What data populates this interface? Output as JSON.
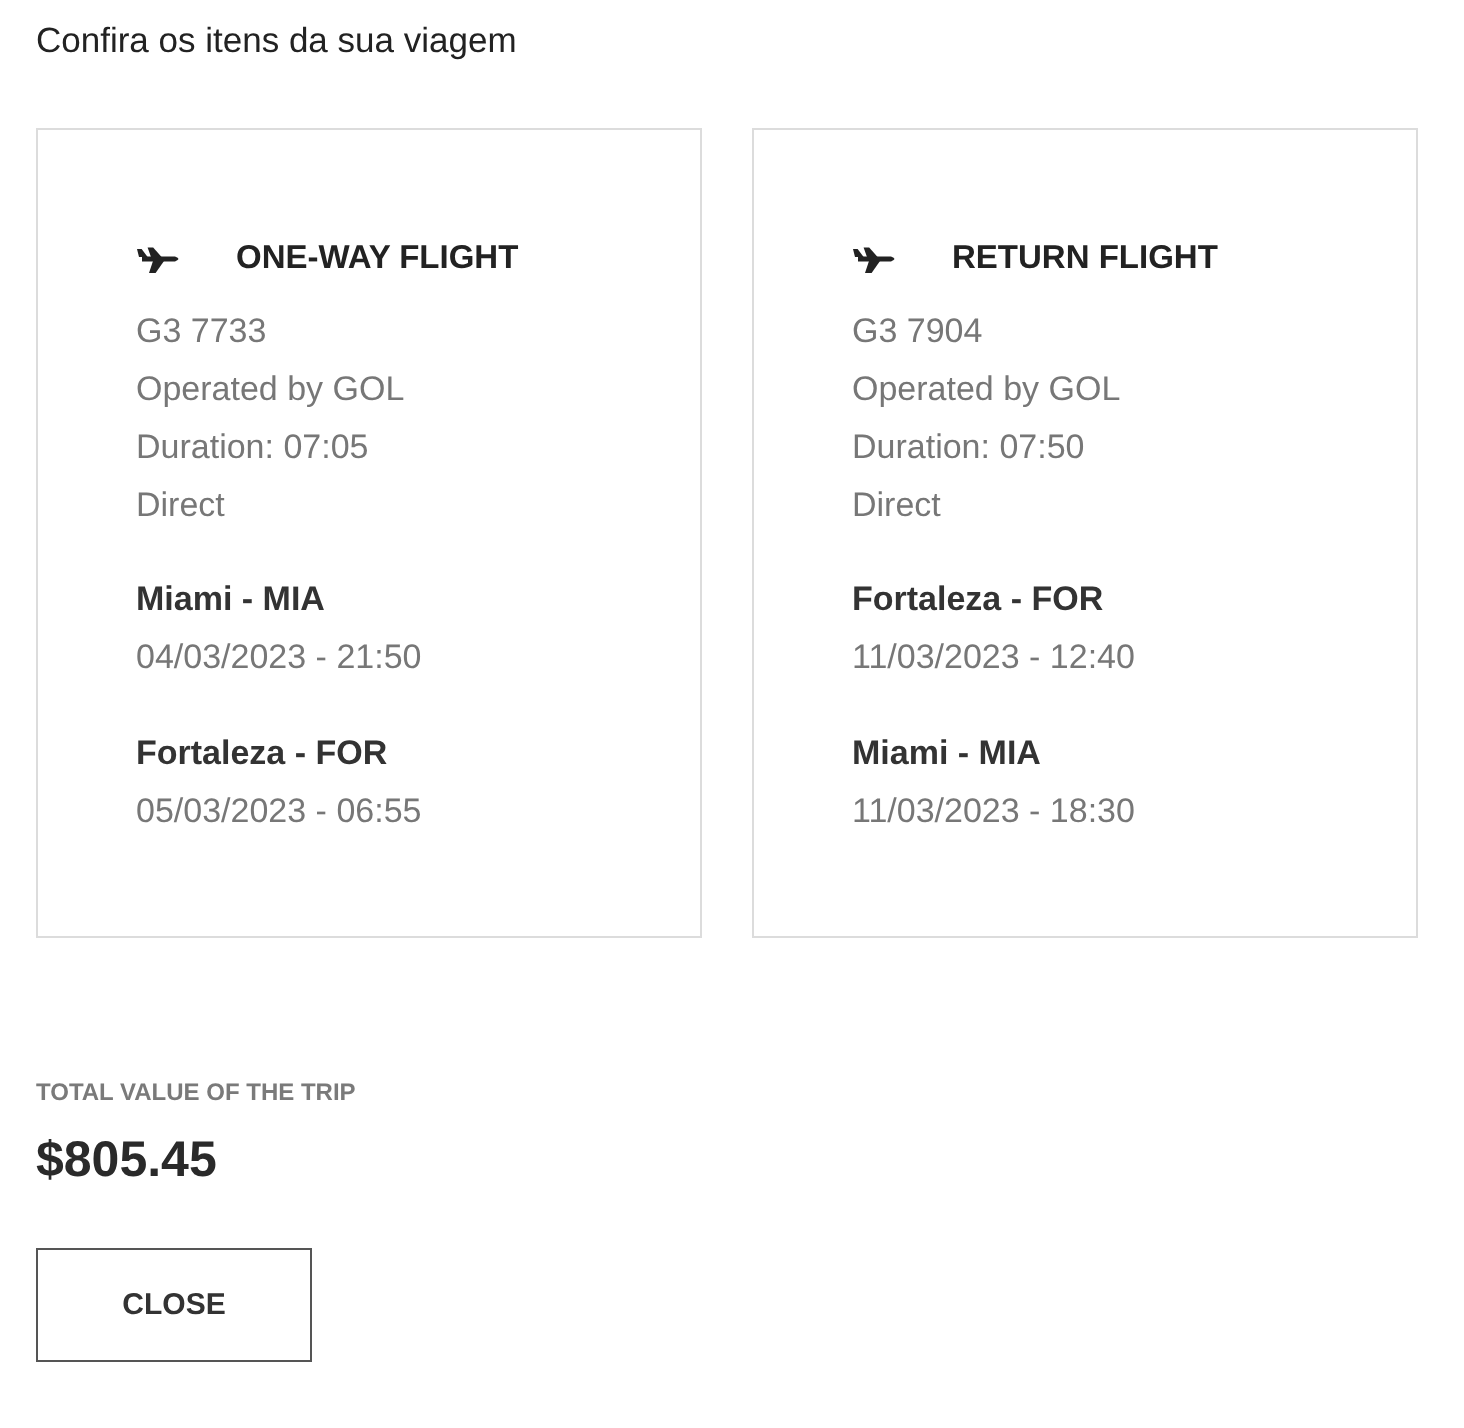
{
  "heading": "Confira os itens da sua viagem",
  "flights": [
    {
      "title": "ONE-WAY FLIGHT",
      "flight_number": "G3 7733",
      "operator": "Operated by GOL",
      "duration": "Duration: 07:05",
      "stops": "Direct",
      "segments": [
        {
          "place": "Miami - MIA",
          "datetime": "04/03/2023 - 21:50"
        },
        {
          "place": "Fortaleza - FOR",
          "datetime": "05/03/2023 - 06:55"
        }
      ]
    },
    {
      "title": "RETURN FLIGHT",
      "flight_number": "G3 7904",
      "operator": "Operated by GOL",
      "duration": "Duration: 07:50",
      "stops": "Direct",
      "segments": [
        {
          "place": "Fortaleza - FOR",
          "datetime": "11/03/2023 - 12:40"
        },
        {
          "place": "Miami - MIA",
          "datetime": "11/03/2023 - 18:30"
        }
      ]
    }
  ],
  "total": {
    "label": "TOTAL VALUE OF THE TRIP",
    "value": "$805.45"
  },
  "buttons": [
    {
      "label": "CLOSE"
    }
  ]
}
